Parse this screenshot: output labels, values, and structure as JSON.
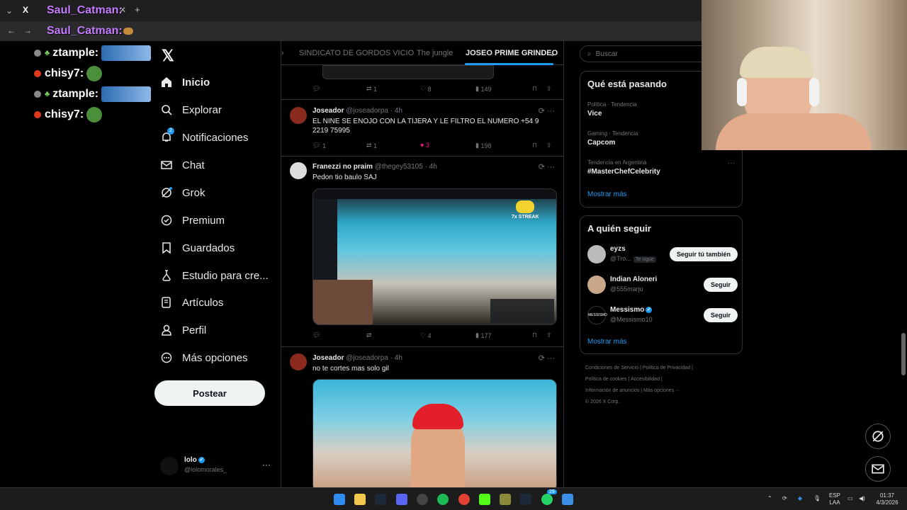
{
  "overlay": {
    "stream_name_top": "Saul_Catman:",
    "stream_name_addr": "Saul_Catman:",
    "chat": [
      {
        "user": "ztample:",
        "color": "#7cdb5c",
        "emote": "car-emote"
      },
      {
        "user": "chisy7:",
        "color": "#7cdb5c",
        "emote": "pepe-emote"
      },
      {
        "user": "ztample:",
        "color": "#7cdb5c",
        "emote": "car-emote"
      },
      {
        "user": "chisy7:",
        "color": "#7cdb5c",
        "emote": "pepe-emote"
      }
    ]
  },
  "sidebar": {
    "items": [
      {
        "label": "Inicio",
        "icon": "home-icon"
      },
      {
        "label": "Explorar",
        "icon": "search-icon"
      },
      {
        "label": "Notificaciones",
        "icon": "bell-icon",
        "badge": "2"
      },
      {
        "label": "Chat",
        "icon": "mail-icon"
      },
      {
        "label": "Grok",
        "icon": "grok-icon"
      },
      {
        "label": "Premium",
        "icon": "premium-icon"
      },
      {
        "label": "Guardados",
        "icon": "bookmark-icon"
      },
      {
        "label": "Estudio para cre...",
        "icon": "studio-icon"
      },
      {
        "label": "Artículos",
        "icon": "article-icon"
      },
      {
        "label": "Perfil",
        "icon": "person-icon"
      },
      {
        "label": "Más opciones",
        "icon": "more-circle-icon"
      }
    ],
    "post_label": "Postear",
    "profile": {
      "name": "lolo",
      "handle": "@lolomorales_"
    }
  },
  "tabs": [
    "SINDICATO DE GORDOS VICIO",
    "The jungle",
    "JOSEO PRIME GRINDEO"
  ],
  "tweets": [
    {
      "replies": "",
      "reposts": "1",
      "likes": "8",
      "views": "149"
    },
    {
      "author": "Joseador",
      "handle": "@joseadorpa",
      "time": "· 4h",
      "text": "EL NINE SE ENOJO CON LA TIJERA Y LE FILTRO EL NUMERO +54 9 2219 75995",
      "replies": "1",
      "reposts": "1",
      "likes": "3",
      "views": "198"
    },
    {
      "author": "Franezzi no praim",
      "handle": "@thegey53105",
      "time": "· 4h",
      "text": "Pedon tio baulo SAJ",
      "replies": "",
      "reposts": "",
      "likes": "4",
      "views": "177",
      "media_caption": "7x STREAK"
    },
    {
      "author": "Joseador",
      "handle": "@joseadorpa",
      "time": "· 4h",
      "text": "no te cortes mas solo gil"
    }
  ],
  "right": {
    "search_placeholder": "Buscar",
    "trends_title": "Qué está pasando",
    "trends": [
      {
        "category": "Política · Tendencia",
        "name": "Vice"
      },
      {
        "category": "Gaming · Tendencia",
        "name": "Capcom"
      },
      {
        "category": "Tendencia en Argentina",
        "name": "#MasterChefCelebrity"
      }
    ],
    "trends_more": "Mostrar más",
    "follow_title": "A quién seguir",
    "follow": [
      {
        "name": "eyzs",
        "handle": "@Tro...",
        "follows_you": "Te sigue",
        "button": "Seguir tú también"
      },
      {
        "name": "Indian Aloneri",
        "handle": "@555marju",
        "button": "Seguir"
      },
      {
        "name": "Messismo",
        "handle": "@Messismo10",
        "button": "Seguir"
      }
    ],
    "follow_more": "Mostrar más",
    "footer": [
      "Condiciones de Servicio",
      "|",
      "Política de Privacidad",
      "|",
      "Política de cookies",
      "|",
      "Accesibilidad",
      "|",
      "Información de anuncios",
      "|",
      "Más opciones ···",
      "© 2026 X Corp."
    ]
  },
  "taskbar": {
    "lang": "ESP",
    "lang2": "LAA",
    "time": "01:37",
    "date": "4/3/2026",
    "badge": "29"
  }
}
